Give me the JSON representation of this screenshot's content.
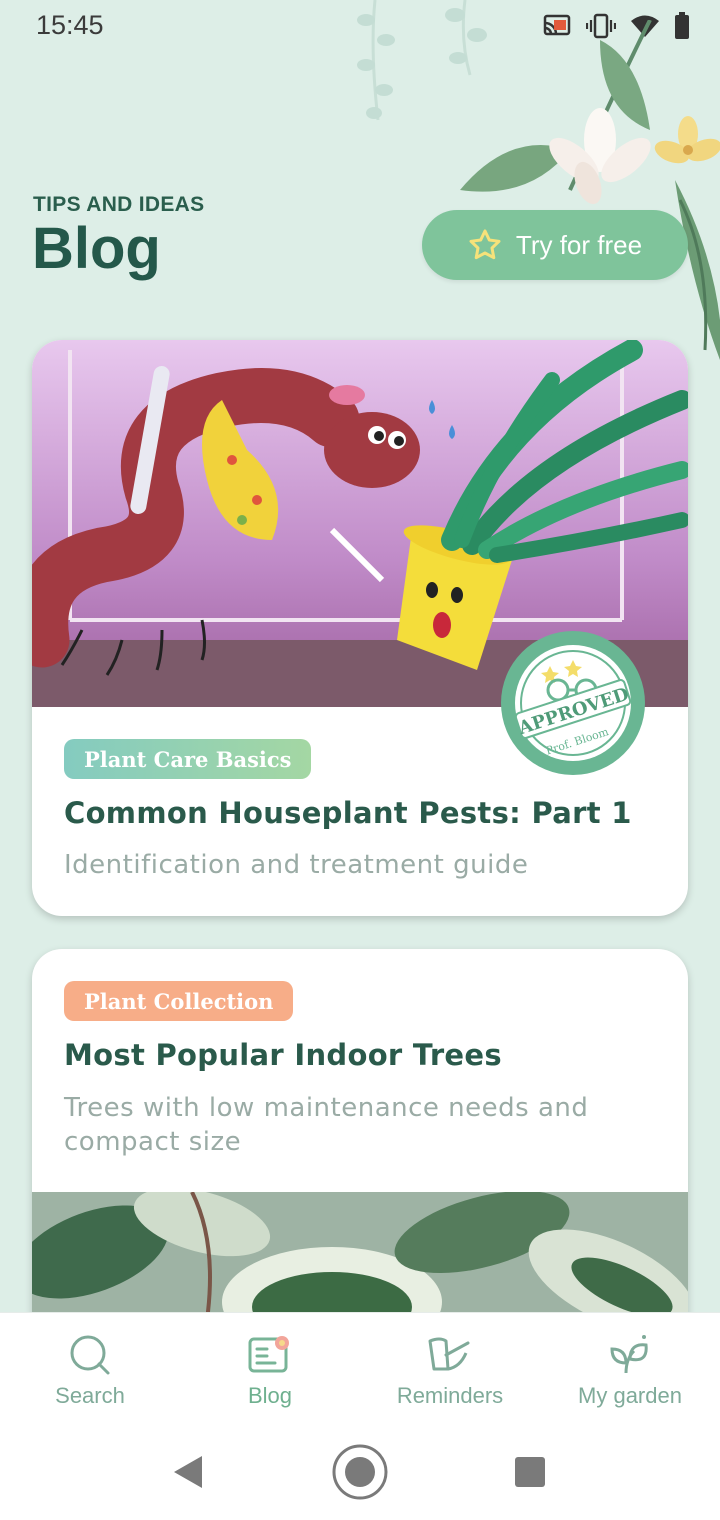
{
  "status_bar": {
    "time": "15:45"
  },
  "header": {
    "kicker": "TIPS AND IDEAS",
    "title": "Blog"
  },
  "try_button": {
    "label": "Try for free"
  },
  "posts": [
    {
      "tag": "Plant Care Basics",
      "title": "Common Houseplant Pests: Part 1",
      "subtitle": "Identification and treatment guide",
      "badge": {
        "main": "APPROVED",
        "sub": "Prof. Bloom"
      }
    },
    {
      "tag": "Plant Collection",
      "title": "Most Popular Indoor Trees",
      "subtitle": "Trees with low maintenance needs and compact size"
    }
  ],
  "bottom_nav": {
    "items": [
      {
        "label": "Search",
        "icon": "search-icon"
      },
      {
        "label": "Blog",
        "icon": "blog-icon"
      },
      {
        "label": "Reminders",
        "icon": "watering-can-icon"
      },
      {
        "label": "My garden",
        "icon": "sprout-icon"
      }
    ],
    "active": "Blog"
  },
  "colors": {
    "background": "#ddeee7",
    "accent": "#7fc49b",
    "title": "#24584a",
    "tag_orange": "#f7ad88"
  }
}
